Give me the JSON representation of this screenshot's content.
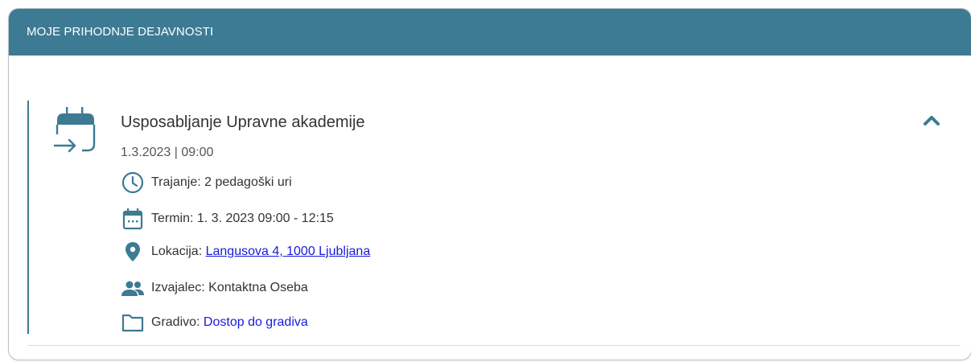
{
  "panel": {
    "title": "MOJE PRIHODNJE DEJAVNOSTI"
  },
  "activity": {
    "title": "Usposabljanje Upravne akademije",
    "datetime": "1.3.2023 | 09:00",
    "duration_label": "Trajanje: 2 pedagoški uri",
    "term_label": "Termin: 1. 3. 2023 09:00 - 12:15",
    "location_prefix": "Lokacija: ",
    "location_link": "Langusova 4, 1000 Ljubljana",
    "performer_label": "Izvajalec: Kontaktna Oseba",
    "materials_prefix": "Gradivo: ",
    "materials_link": "Dostop do gradiva",
    "expanded": true
  },
  "icons": {
    "event": "calendar-arrow-icon",
    "duration": "clock-icon",
    "term": "calendar-icon",
    "location": "map-pin-icon",
    "performer": "people-icon",
    "materials": "folder-icon",
    "toggle": "chevron-up-icon"
  },
  "colors": {
    "header_bg": "#3d7a94",
    "accent": "#3d7a94",
    "link": "#1a1adb"
  }
}
